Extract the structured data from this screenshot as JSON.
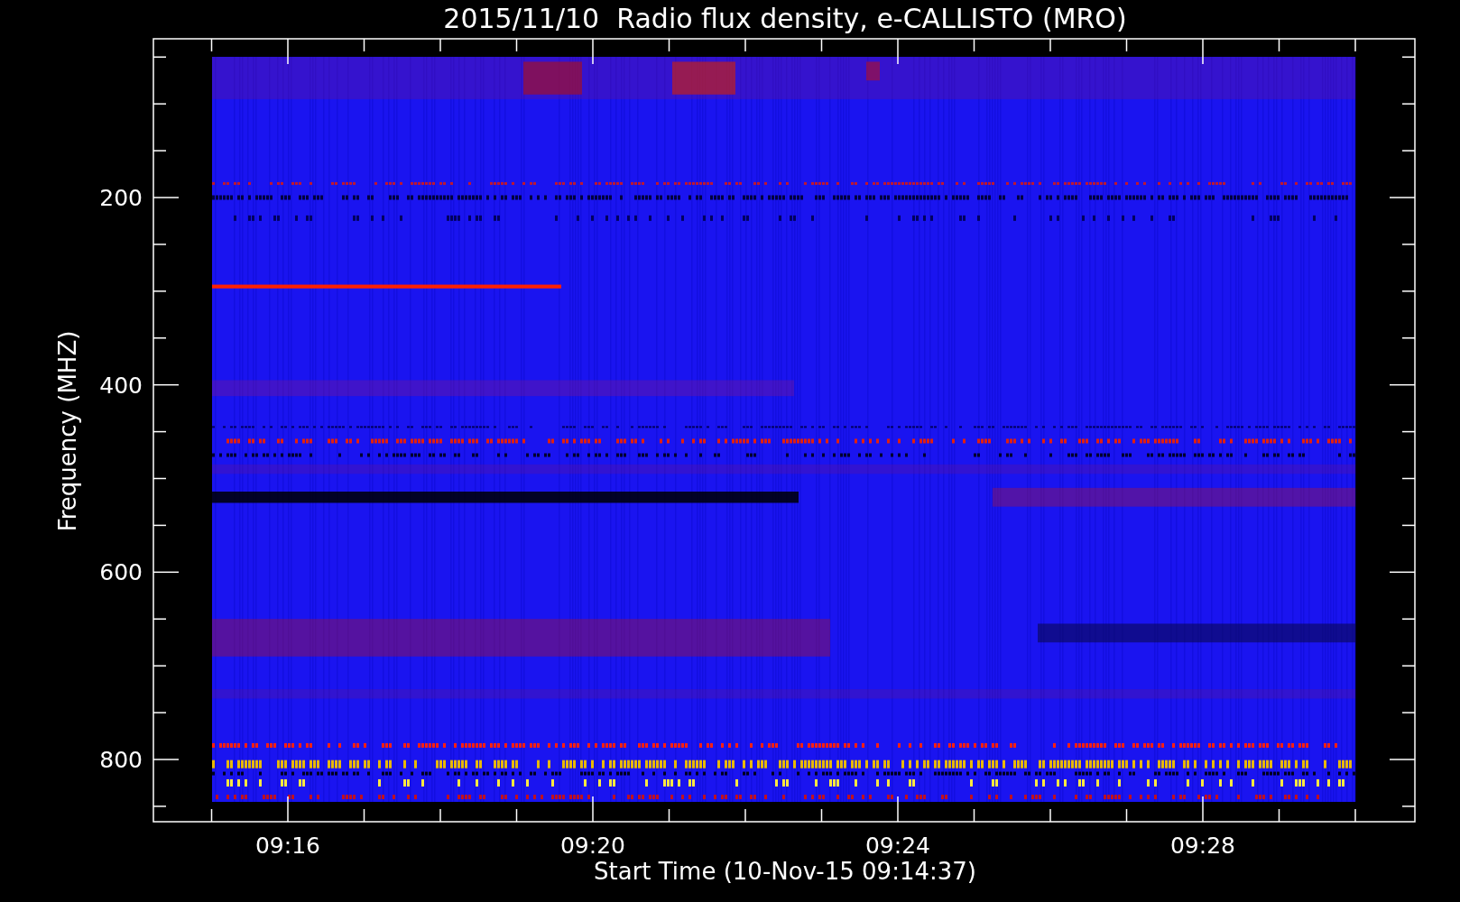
{
  "title": "2015/11/10  Radio flux density, e-CALLISTO (MRO)",
  "y_axis": {
    "label": "Frequency (MHZ)",
    "ticks": [
      "200",
      "400",
      "600",
      "800"
    ]
  },
  "x_axis": {
    "label": "Start Time (10-Nov-15 09:14:37)",
    "ticks": [
      "09:16",
      "09:20",
      "09:24",
      "09:28"
    ]
  }
}
